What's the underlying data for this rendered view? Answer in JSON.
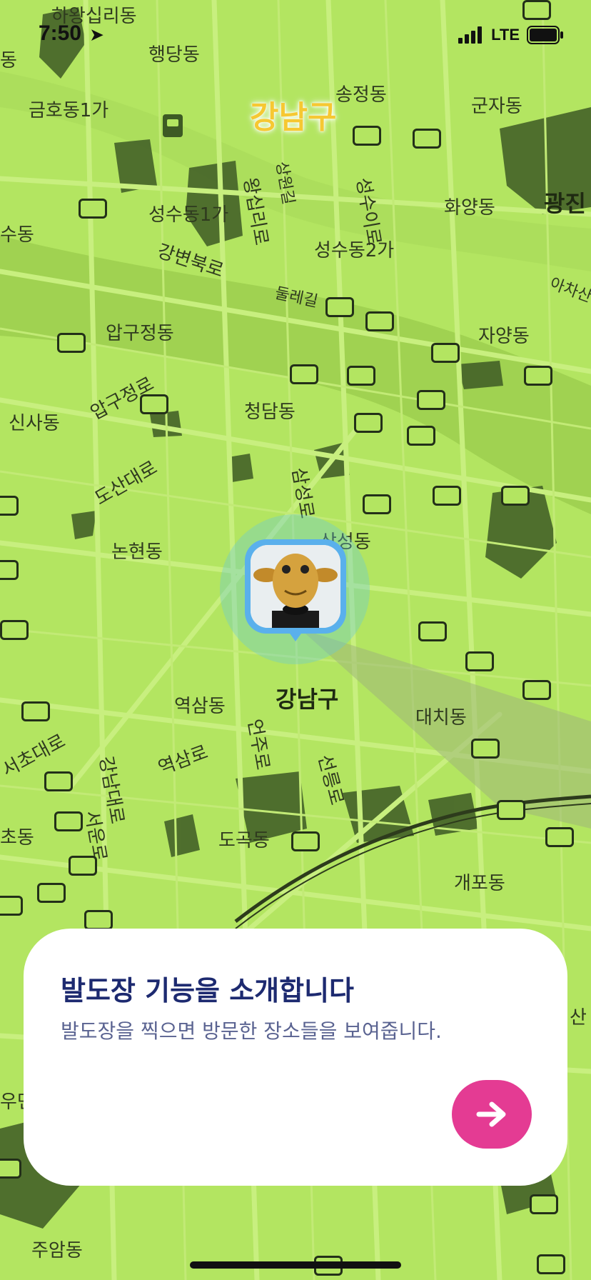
{
  "status_bar": {
    "time": "7:50",
    "network": "LTE"
  },
  "district_title": "강남구",
  "map_labels": [
    {
      "text": "하왕십리동"
    },
    {
      "text": "행당동"
    },
    {
      "text": "송정동"
    },
    {
      "text": "군자동"
    },
    {
      "text": "금호동1가"
    },
    {
      "text": "성수동1가"
    },
    {
      "text": "성수동2가"
    },
    {
      "text": "화양동"
    },
    {
      "text": "광진"
    },
    {
      "text": "강변북로"
    },
    {
      "text": "둘레길"
    },
    {
      "text": "압구정동"
    },
    {
      "text": "자양동"
    },
    {
      "text": "신사동"
    },
    {
      "text": "압구정로"
    },
    {
      "text": "청담동"
    },
    {
      "text": "도산대로"
    },
    {
      "text": "논현동"
    },
    {
      "text": "삼성동"
    },
    {
      "text": "삼성로"
    },
    {
      "text": "역삼동"
    },
    {
      "text": "강남구"
    },
    {
      "text": "대치동"
    },
    {
      "text": "서초대로"
    },
    {
      "text": "역삼로"
    },
    {
      "text": "언주로"
    },
    {
      "text": "선릉로"
    },
    {
      "text": "강남대로"
    },
    {
      "text": "서운로"
    },
    {
      "text": "도곡동"
    },
    {
      "text": "개포동"
    },
    {
      "text": "주암동"
    },
    {
      "text": "왕십리로"
    },
    {
      "text": "상원길"
    },
    {
      "text": "성수이로"
    },
    {
      "text": "수동"
    },
    {
      "text": "초동"
    },
    {
      "text": "아차산"
    },
    {
      "text": "동"
    },
    {
      "text": "우면"
    },
    {
      "text": "산"
    }
  ],
  "card": {
    "title": "발도장 기능을 소개합니다",
    "description": "발도장을 찍으면 방문한 장소들을 보여줍니다.",
    "next_icon": "arrow-right-icon"
  },
  "colors": {
    "map_background": "#b3e561",
    "road": "#c8ef7f",
    "dark_area": "#3d5a24",
    "river": "#9ccf4f",
    "accent_pink": "#e43b93",
    "title_navy": "#1d2a70",
    "district_title_yellow": "#f6c832"
  }
}
